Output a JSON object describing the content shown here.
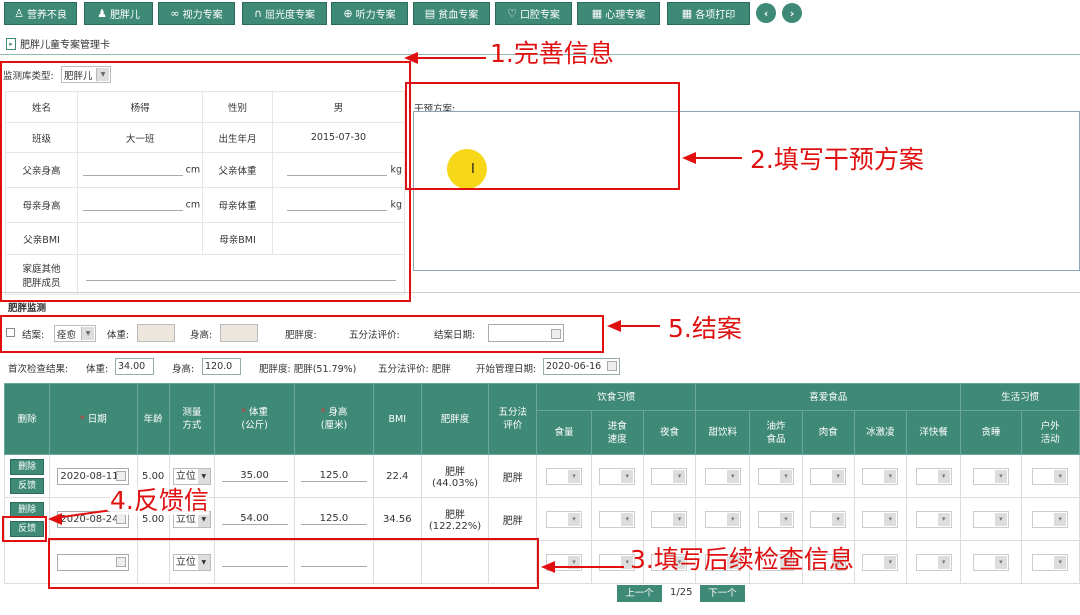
{
  "toolbar": {
    "items": [
      {
        "label": "营养不良",
        "icon": "person-icon"
      },
      {
        "label": "肥胖儿",
        "icon": "child-icon"
      },
      {
        "label": "视力专案",
        "icon": "glasses-icon"
      },
      {
        "label": "屈光度专案",
        "icon": "headphones-icon"
      },
      {
        "label": "听力专案",
        "icon": "plus-circle-icon"
      },
      {
        "label": "贫血专案",
        "icon": "document-icon"
      },
      {
        "label": "口腔专案",
        "icon": "heart-icon"
      },
      {
        "label": "心理专案",
        "icon": "grid-icon"
      },
      {
        "label": "各项打印",
        "icon": "grid-icon"
      }
    ],
    "prev": "‹",
    "next": "›"
  },
  "page_title": "肥胖儿童专案管理卡",
  "monitor": {
    "label": "监测库类型:",
    "value": "肥胖儿"
  },
  "info": {
    "name_label": "姓名",
    "name": "杨得",
    "gender_label": "性别",
    "gender": "男",
    "class_label": "班级",
    "class": "大一班",
    "birth_label": "出生年月",
    "birth": "2015-07-30",
    "father_height_label": "父亲身高",
    "father_weight_label": "父亲体重",
    "mother_height_label": "母亲身高",
    "mother_weight_label": "母亲体重",
    "unit_cm": "cm",
    "unit_kg": "kg",
    "father_bmi_label": "父亲BMI",
    "mother_bmi_label": "母亲BMI",
    "family_label_1": "家庭其他",
    "family_label_2": "肥胖成员"
  },
  "intervention": {
    "label": "干预方案:"
  },
  "section_title": "肥胖监测",
  "close_case": {
    "checkbox_label": "结案:",
    "reason": "痊愈",
    "weight_label": "体重:",
    "height_label": "身高:",
    "degree_label": "肥胖度:",
    "five_label": "五分法评价:",
    "date_label": "结案日期:"
  },
  "first_check": {
    "label": "首次检查结果:",
    "weight_label": "体重:",
    "weight": "34.00",
    "height_label": "身高:",
    "height": "120.0",
    "degree": "肥胖度: 肥胖(51.79%)",
    "five": "五分法评价: 肥胖",
    "start_label": "开始管理日期:",
    "start_date": "2020-06-16"
  },
  "table": {
    "h_delete": "删除",
    "h_date": "日期",
    "h_age": "年龄",
    "h_method_1": "测量",
    "h_method_2": "方式",
    "h_weight_1": "体重",
    "h_weight_2": "(公斤)",
    "h_height_1": "身高",
    "h_height_2": "(厘米)",
    "h_bmi": "BMI",
    "h_degree": "肥胖度",
    "h_five_1": "五分法",
    "h_five_2": "评价",
    "g_diet": "饮食习惯",
    "g_food": "喜爱食品",
    "g_life": "生活习惯",
    "h_amount": "食量",
    "h_speed_1": "进食",
    "h_speed_2": "速度",
    "h_night": "夜食",
    "h_sweet": "甜饮料",
    "h_fried_1": "油炸",
    "h_fried_2": "食品",
    "h_meat": "肉食",
    "h_ice": "冰激凌",
    "h_fast": "洋快餐",
    "h_sleep": "贪睡",
    "h_outdoor_1": "户外",
    "h_outdoor_2": "活动",
    "btn_delete": "删除",
    "btn_feedback": "反馈",
    "rows": [
      {
        "date": "2020-08-11",
        "age": "5.00",
        "method": "立位",
        "weight": "35.00",
        "height": "125.0",
        "bmi": "22.4",
        "degree_1": "肥胖",
        "degree_2": "(44.03%)",
        "five": "肥胖"
      },
      {
        "date": "2020-08-24",
        "age": "5.00",
        "method": "立位",
        "weight": "54.00",
        "height": "125.0",
        "bmi": "34.56",
        "degree_1": "肥胖",
        "degree_2": "(122.22%)",
        "five": "肥胖"
      }
    ],
    "new_row": {
      "method": "立位"
    }
  },
  "pagination": {
    "prev": "上一个",
    "info": "1/25",
    "next": "下一个"
  },
  "annotations": {
    "a1": "1.完善信息",
    "a2": "2.填写干预方案",
    "a3": "3.填写后续检查信息",
    "a4": "4.反馈信",
    "a5": "5.结案"
  },
  "colors": {
    "accent": "#3f8a77",
    "annotation": "#e01010",
    "cursor": "#f5d400"
  }
}
